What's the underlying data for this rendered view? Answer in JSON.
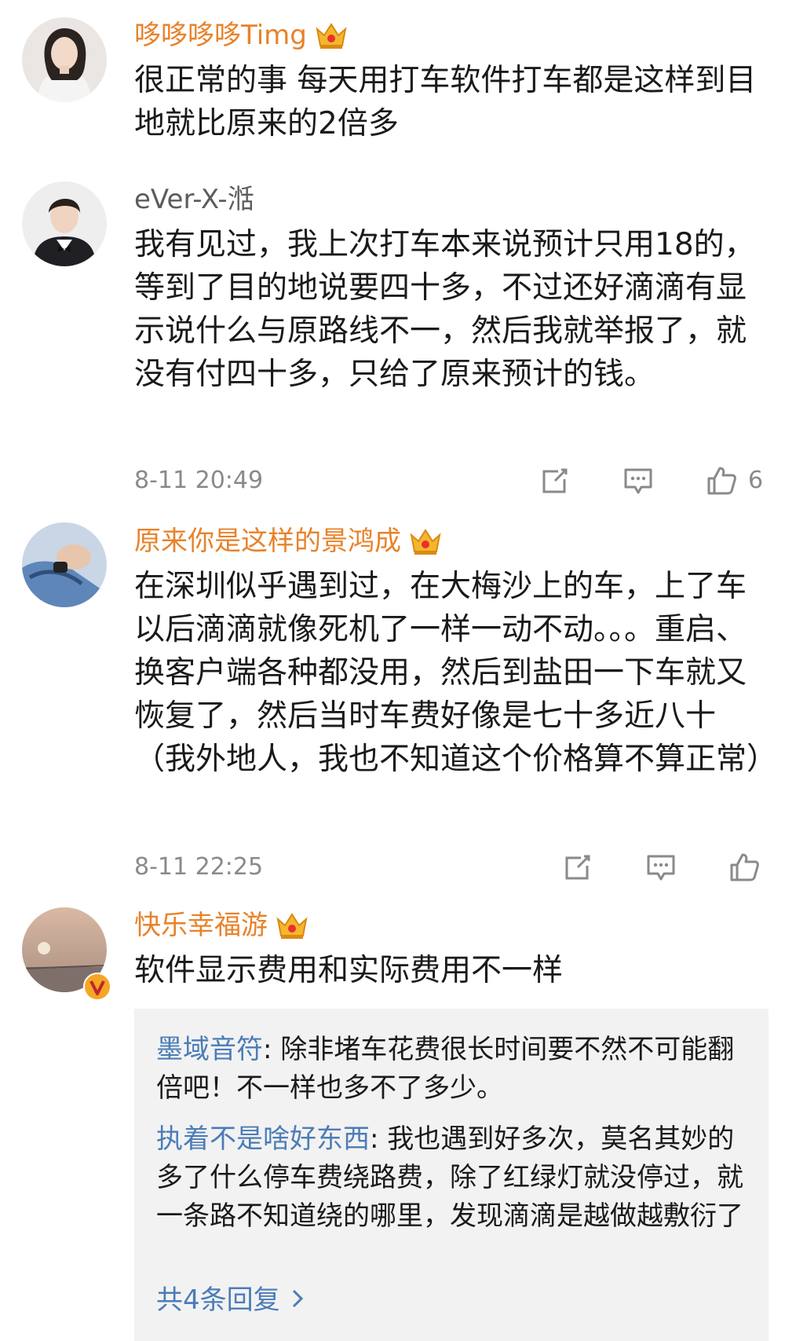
{
  "comments": [
    {
      "username": "哆哆哆哆Timg",
      "text": "很正常的事 每天用打车软件打车都是这样到目地就比原来的2倍多"
    },
    {
      "username": "eVer-X-湉",
      "text": "我有见过，我上次打车本来说预计只用18的，等到了目的地说要四十多，不过还好滴滴有显示说什么与原路线不一，然后我就举报了，就没有付四十多，只给了原来预计的钱。",
      "timestamp": "8-11 20:49",
      "like_count": "6"
    },
    {
      "username": "原来你是这样的景鸿成",
      "text": "在深圳似乎遇到过，在大梅沙上的车，上了车以后滴滴就像死机了一样一动不动。。。重启、换客户端各种都没用，然后到盐田一下车就又恢复了，然后当时车费好像是七十多近八十（我外地人，我也不知道这个价格算不算正常）",
      "timestamp": "8-11 22:25"
    },
    {
      "username": "快乐幸福游",
      "text": "软件显示费用和实际费用不一样"
    }
  ],
  "replies": [
    {
      "author": "墨域音符",
      "text": ": 除非堵车花费很长时间要不然不可能翻倍吧！不一样也多不了多少。"
    },
    {
      "author": "执着不是啥好东西",
      "text": ": 我也遇到好多次，莫名其妙的多了什么停车费绕路费，除了红绿灯就没停过，就一条路不知道绕的哪里，发现滴滴是越做越敷衍了"
    }
  ],
  "more_replies_label": "共4条回复",
  "colors": {
    "vip_name": "#e8822a",
    "plain_name": "#5c5c5c",
    "reply_author": "#4b7cb7",
    "meta_gray": "#8a8a8a",
    "reply_bg": "#f2f2f2",
    "verified_badge": "#f5a623"
  },
  "icons": [
    "crown-icon",
    "share-icon",
    "comment-icon",
    "like-icon",
    "chevron-right-icon",
    "verified-badge-icon"
  ]
}
